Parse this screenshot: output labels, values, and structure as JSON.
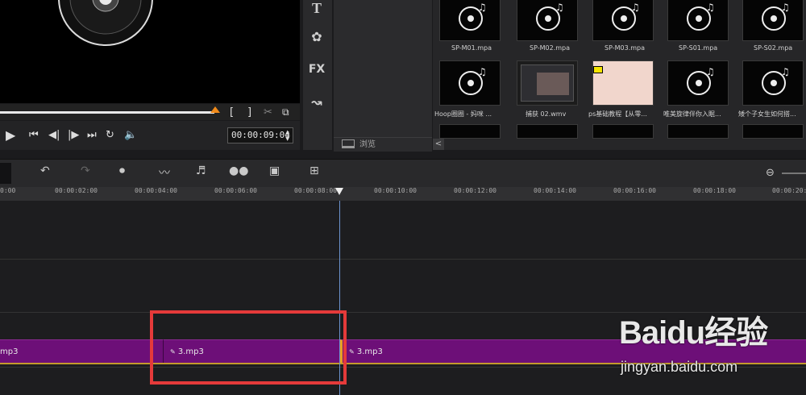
{
  "transport": {
    "play_icon": "play-icon",
    "timecode": "00:00:09:04",
    "mark_in": "[",
    "mark_out": "]",
    "scrub_progress": 0.715
  },
  "library_nav": {
    "title_icon": "T",
    "fx_label": "FX"
  },
  "browse": {
    "label": "浏览"
  },
  "library": {
    "row1": [
      "SP-M01.mpa",
      "SP-M02.mpa",
      "SP-M03.mpa",
      "SP-S01.mpa",
      "SP-S02.mpa"
    ],
    "row2": [
      "Hoop圈圈 - 妈咪 ...",
      "捕获 02.wmv",
      "ps基础教程【从零...",
      "唯美旋律伴你入眠...",
      "矮个子女生如何搭..."
    ],
    "scroll_left": "<"
  },
  "ruler": {
    "ticks": [
      "0:00",
      "00:00:02:00",
      "00:00:04:00",
      "00:00:06:00",
      "00:00:08:00",
      "00:00:10:00",
      "00:00:12:00",
      "00:00:14:00",
      "00:00:16:00",
      "00:00:18:00",
      "00:00:20:0"
    ]
  },
  "timeline": {
    "clips": [
      "mp3",
      "3.mp3",
      "3.mp3"
    ]
  },
  "watermark": {
    "brand": "Baidu经验",
    "url": "jingyan.baidu.com"
  },
  "colors": {
    "clip": "#6d0f78",
    "playhead": "#6d94d0",
    "highlight": "#e53a3a",
    "scrub_handle": "#f08a1a"
  }
}
